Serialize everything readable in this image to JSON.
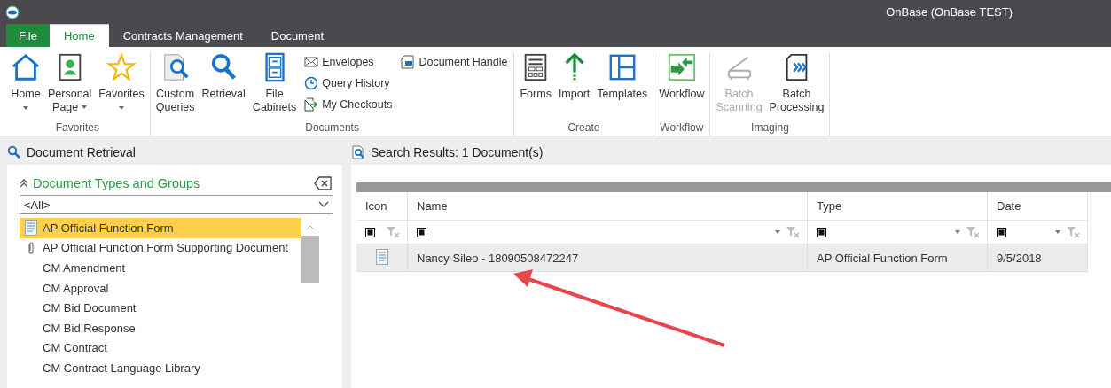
{
  "window": {
    "title": "OnBase (OnBase TEST)"
  },
  "tabs": [
    {
      "label": "File",
      "kind": "file",
      "selected": false
    },
    {
      "label": "Home",
      "kind": "tab",
      "selected": true
    },
    {
      "label": "Contracts Management",
      "kind": "tab",
      "selected": false
    },
    {
      "label": "Document",
      "kind": "tab",
      "selected": false
    }
  ],
  "ribbon": {
    "groups": [
      {
        "label": "Favorites",
        "buttons": [
          {
            "lines": [
              "Home"
            ],
            "kind": "house",
            "dropdown": true,
            "disabled": false
          },
          {
            "lines": [
              "Personal",
              "Page"
            ],
            "kind": "person",
            "dropdown": true,
            "disabled": false
          },
          {
            "lines": [
              "Favorites"
            ],
            "kind": "star",
            "dropdown": true,
            "disabled": false
          }
        ]
      },
      {
        "label": "Documents",
        "buttons": [
          {
            "lines": [
              "Custom",
              "Queries"
            ],
            "kind": "query",
            "dropdown": false,
            "disabled": false
          },
          {
            "lines": [
              "Retrieval"
            ],
            "kind": "search",
            "dropdown": false,
            "disabled": false
          },
          {
            "lines": [
              "File",
              "Cabinets"
            ],
            "kind": "cabinet",
            "dropdown": false,
            "disabled": false
          }
        ],
        "small": [
          [
            {
              "label": "Envelopes",
              "kind": "envelope"
            },
            {
              "label": "Query History",
              "kind": "clock"
            },
            {
              "label": "My Checkouts",
              "kind": "checkout"
            }
          ],
          [
            {
              "label": "Document Handle",
              "kind": "handle"
            }
          ]
        ]
      },
      {
        "label": "Create",
        "buttons": [
          {
            "lines": [
              "Forms"
            ],
            "kind": "forms",
            "dropdown": false,
            "disabled": false
          },
          {
            "lines": [
              "Import"
            ],
            "kind": "import",
            "dropdown": false,
            "disabled": false
          },
          {
            "lines": [
              "Templates"
            ],
            "kind": "templates",
            "dropdown": false,
            "disabled": false
          }
        ]
      },
      {
        "label": "Workflow",
        "buttons": [
          {
            "lines": [
              "Workflow"
            ],
            "kind": "workflow",
            "dropdown": false,
            "disabled": false
          }
        ]
      },
      {
        "label": "Imaging",
        "buttons": [
          {
            "lines": [
              "Batch",
              "Scanning"
            ],
            "kind": "scanner",
            "dropdown": false,
            "disabled": true
          },
          {
            "lines": [
              "Batch",
              "Processing"
            ],
            "kind": "batch",
            "dropdown": false,
            "disabled": false
          }
        ]
      }
    ]
  },
  "retrieval": {
    "title": "Document Retrieval",
    "section": "Document Types and Groups",
    "filter": {
      "value": "<All>"
    },
    "items": [
      {
        "label": "AP Official Function Form",
        "kind": "form",
        "selected": true
      },
      {
        "label": "AP Official Function Form Supporting Document",
        "kind": "clip",
        "selected": false
      },
      {
        "label": "CM Amendment",
        "kind": "plain",
        "selected": false
      },
      {
        "label": "CM Approval",
        "kind": "plain",
        "selected": false
      },
      {
        "label": "CM Bid Document",
        "kind": "plain",
        "selected": false
      },
      {
        "label": "CM Bid Response",
        "kind": "plain",
        "selected": false
      },
      {
        "label": "CM Contract",
        "kind": "plain",
        "selected": false
      },
      {
        "label": "CM Contract Language Library",
        "kind": "plain",
        "selected": false
      }
    ]
  },
  "results": {
    "title": "Search Results: 1 Document(s)",
    "columns": [
      "Icon",
      "Name",
      "Type",
      "Date"
    ],
    "rows": [
      {
        "name": "Nancy Sileo - 18090508472247",
        "type": "AP Official Function Form",
        "date": "9/5/2018"
      }
    ]
  }
}
